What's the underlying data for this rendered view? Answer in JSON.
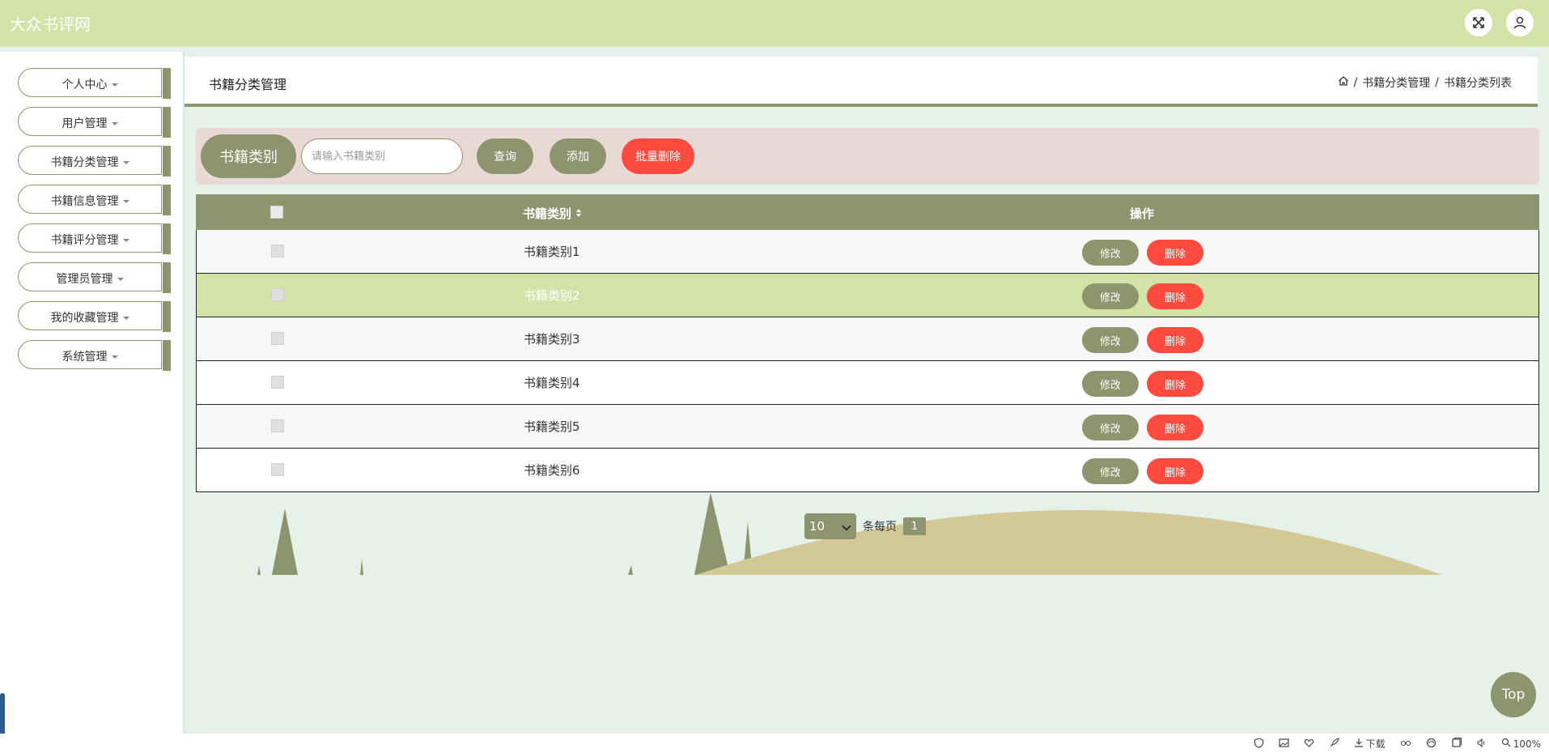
{
  "app": {
    "title": "大众书评网"
  },
  "topbar": {
    "icons": [
      "fullscreen-icon",
      "user-icon"
    ]
  },
  "sidebar": {
    "items": [
      {
        "label": "个人中心"
      },
      {
        "label": "用户管理"
      },
      {
        "label": "书籍分类管理"
      },
      {
        "label": "书籍信息管理"
      },
      {
        "label": "书籍评分管理"
      },
      {
        "label": "管理员管理"
      },
      {
        "label": "我的收藏管理"
      },
      {
        "label": "系统管理"
      }
    ]
  },
  "header": {
    "title": "书籍分类管理",
    "breadcrumb": {
      "sep1": "/",
      "item1": "书籍分类管理",
      "sep2": "/",
      "item2": "书籍分类列表"
    }
  },
  "search": {
    "label": "书籍类别",
    "placeholder": "请输入书籍类别",
    "query_button": "查询",
    "add_button": "添加",
    "batch_delete_button": "批量删除"
  },
  "table": {
    "columns": {
      "name": "书籍类别",
      "actions": "操作"
    },
    "edit_label": "修改",
    "delete_label": "删除",
    "rows": [
      {
        "name": "书籍类别1"
      },
      {
        "name": "书籍类别2"
      },
      {
        "name": "书籍类别3"
      },
      {
        "name": "书籍类别4"
      },
      {
        "name": "书籍类别5"
      },
      {
        "name": "书籍类别6"
      }
    ]
  },
  "pagination": {
    "page_size": "10",
    "per_page_label": "条每页",
    "current_page": "1"
  },
  "top_button": "Top",
  "statusbar": {
    "download_label": "下载",
    "zoom": "100%"
  },
  "colors": {
    "primary": "#8c956d",
    "accent_green": "#d3e3a8",
    "danger": "#ff4a40",
    "background": "#e6f1ea"
  }
}
